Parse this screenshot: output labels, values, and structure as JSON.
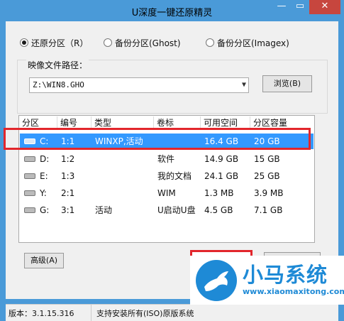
{
  "window": {
    "title": "U深度一键还原精灵",
    "minimize": "—",
    "maximize": "▭",
    "close": "✕"
  },
  "modes": [
    {
      "label": "还原分区（R）",
      "selected": true
    },
    {
      "label": "备份分区(Ghost)",
      "selected": false
    },
    {
      "label": "备份分区(Imagex)",
      "selected": false
    }
  ],
  "image_path": {
    "label": "映像文件路径：",
    "value": "Z:\\WIN8.GHO",
    "browse_label": "浏览(B)"
  },
  "table": {
    "columns": [
      "分区",
      "编号",
      "类型",
      "卷标",
      "可用空间",
      "分区容量"
    ],
    "rows": [
      {
        "drive": "C:",
        "num": "1:1",
        "type": "WINXP,活动",
        "label": "",
        "free": "16.4 GB",
        "size": "20 GB",
        "selected": true
      },
      {
        "drive": "D:",
        "num": "1:2",
        "type": "",
        "label": "软件",
        "free": "14.9 GB",
        "size": "15 GB",
        "selected": false
      },
      {
        "drive": "E:",
        "num": "1:3",
        "type": "",
        "label": "我的文档",
        "free": "24.1 GB",
        "size": "25 GB",
        "selected": false
      },
      {
        "drive": "Y:",
        "num": "2:1",
        "type": "",
        "label": "WIM",
        "free": "1.3 MB",
        "size": "3.9 MB",
        "selected": false
      },
      {
        "drive": "G:",
        "num": "3:1",
        "type": "活动",
        "label": "U启动U盘",
        "free": "4.5 GB",
        "size": "7.1 GB",
        "selected": false
      }
    ]
  },
  "buttons": {
    "advanced": "高级(A)"
  },
  "status": {
    "version": "版本：3.1.15.316",
    "support": "支持安装所有(ISO)原版系统"
  },
  "watermark": {
    "text": "小马系统",
    "url": "www.xiaomaxitong.com"
  },
  "colors": {
    "titlebar": "#4a9ad8",
    "selection": "#3399ff",
    "highlight_red": "#e2262c",
    "watermark_blue": "#1e8ad6"
  }
}
